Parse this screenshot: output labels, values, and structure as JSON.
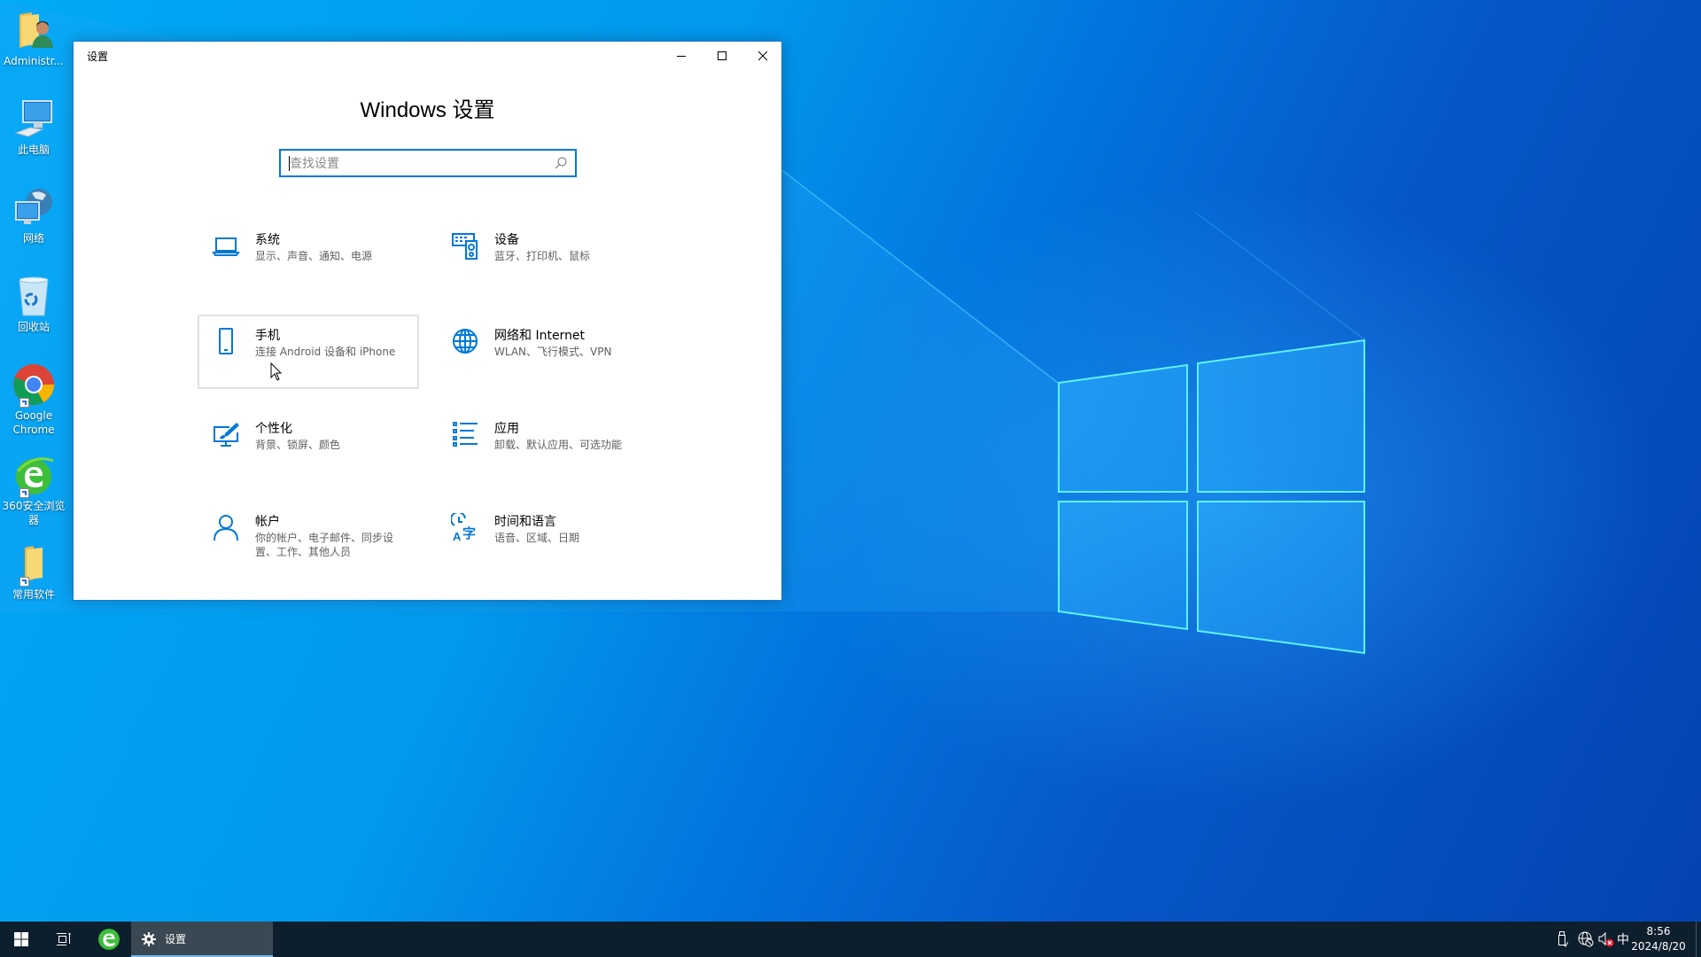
{
  "desktop": {
    "icons": [
      {
        "label": "Administr...",
        "icon": "user-folder-icon"
      },
      {
        "label": "此电脑",
        "icon": "computer-icon"
      },
      {
        "label": "网络",
        "icon": "network-icon"
      },
      {
        "label": "回收站",
        "icon": "recycle-bin-icon"
      },
      {
        "label": "Google Chrome",
        "icon": "chrome-icon",
        "shortcut": true
      },
      {
        "label": "360安全浏览器",
        "icon": "360-browser-icon",
        "shortcut": true
      },
      {
        "label": "常用软件",
        "icon": "folder-icon",
        "shortcut": true
      }
    ]
  },
  "window": {
    "title": "设置",
    "heading": "Windows 设置",
    "controls": {
      "minimize": "minimize-icon",
      "maximize": "maximize-icon",
      "close": "close-icon"
    },
    "search": {
      "value": "",
      "placeholder": "查找设置"
    },
    "accent": "#0078d7",
    "tiles": [
      {
        "name": "系统",
        "desc": "显示、声音、通知、电源",
        "icon": "laptop-icon"
      },
      {
        "name": "设备",
        "desc": "蓝牙、打印机、鼠标",
        "icon": "devices-icon"
      },
      {
        "name": "手机",
        "desc": "连接 Android 设备和 iPhone",
        "icon": "phone-icon",
        "hovered": true
      },
      {
        "name": "网络和 Internet",
        "desc": "WLAN、飞行模式、VPN",
        "icon": "globe-icon"
      },
      {
        "name": "个性化",
        "desc": "背景、锁屏、颜色",
        "icon": "personalization-icon"
      },
      {
        "name": "应用",
        "desc": "卸载、默认应用、可选功能",
        "icon": "apps-list-icon"
      },
      {
        "name": "帐户",
        "desc": "你的帐户、电子邮件、同步设置、工作、其他人员",
        "icon": "person-icon"
      },
      {
        "name": "时间和语言",
        "desc": "语音、区域、日期",
        "icon": "time-language-icon"
      }
    ]
  },
  "taskbar": {
    "task_label": "设置",
    "ime": "中",
    "time": "8:56",
    "date": "2024/8/20"
  }
}
